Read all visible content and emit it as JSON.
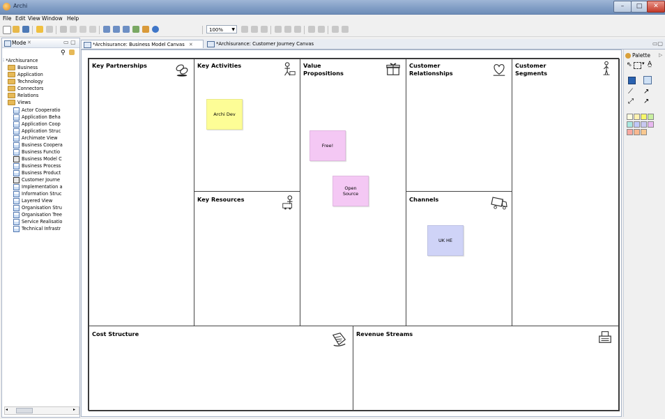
{
  "window": {
    "title": "Archi"
  },
  "menu": [
    "File",
    "Edit",
    "View",
    "Window",
    "Help"
  ],
  "toolbar": {
    "zoom": "100%"
  },
  "model_tree": {
    "tab_label": "Mode",
    "root": "*Archisurance",
    "folders": [
      "Business",
      "Application",
      "Technology",
      "Connectors",
      "Relations",
      "Views"
    ],
    "views": [
      "Actor Cooperatio",
      "Application Beha",
      "Application Coop",
      "Application Struc",
      "Archimate View",
      "Business Coopera",
      "Business Functio",
      "Business Model C",
      "Business Process",
      "Business Product",
      "Customer Journe",
      "Implementation a",
      "Information Struc",
      "Layered View",
      "Organisation Stru",
      "Organisation Tree",
      "Service Realisatio",
      "Technical Infrastr"
    ]
  },
  "editor_tabs": [
    {
      "label": "*Archisurance: Business Model Canvas"
    },
    {
      "label": "*Archisurance: Customer Journey Canvas"
    }
  ],
  "canvas": {
    "key_partnerships": "Key Partnerships",
    "key_activities": "Key Activities",
    "key_resources": "Key Resources",
    "value_propositions": "Value Propositions",
    "customer_relationships": "Customer Relationships",
    "channels": "Channels",
    "customer_segments": "Customer Segments",
    "cost_structure": "Cost Structure",
    "revenue_streams": "Revenue Streams"
  },
  "stickies": {
    "archi_dev": "Archi Dev",
    "free": "Free!",
    "open_source": "Open Source",
    "uk_he": "UK HE"
  },
  "palette": {
    "title": "Palette"
  },
  "colors": {
    "sticky_yellow": "#fdfd96",
    "sticky_pink": "#f4c8f4",
    "sticky_blue": "#cfd3f7"
  }
}
